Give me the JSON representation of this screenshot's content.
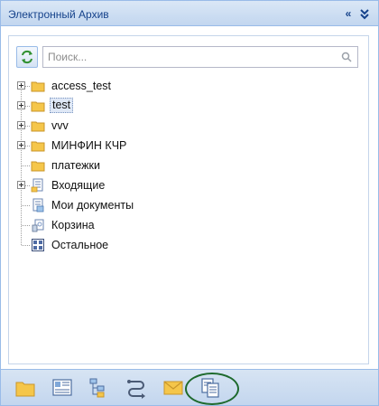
{
  "header": {
    "title": "Электронный Архив",
    "collapse_icon": "double-chevron-left-icon",
    "expand_icon": "double-chevron-down-icon"
  },
  "search": {
    "placeholder": "Поиск...",
    "value": ""
  },
  "tree": {
    "items": [
      {
        "label": "access_test",
        "icon": "folder-icon",
        "expandable": true,
        "selected": false
      },
      {
        "label": "test",
        "icon": "folder-icon",
        "expandable": true,
        "selected": true
      },
      {
        "label": "vvv",
        "icon": "folder-icon",
        "expandable": true,
        "selected": false
      },
      {
        "label": "МИНФИН КЧР",
        "icon": "folder-icon",
        "expandable": true,
        "selected": false
      },
      {
        "label": "платежки",
        "icon": "folder-icon",
        "expandable": false,
        "selected": false
      },
      {
        "label": "Входящие",
        "icon": "incoming-documents-icon",
        "expandable": true,
        "selected": false
      },
      {
        "label": "Мои документы",
        "icon": "my-documents-icon",
        "expandable": false,
        "selected": false
      },
      {
        "label": "Корзина",
        "icon": "recycle-bin-icon",
        "expandable": false,
        "selected": false
      },
      {
        "label": "Остальное",
        "icon": "other-grid-icon",
        "expandable": false,
        "selected": false
      }
    ]
  },
  "footer": {
    "buttons": [
      "folder-icon",
      "card-list-icon",
      "tree-structure-icon",
      "workflow-icon",
      "mail-icon",
      "documents-copy-icon"
    ],
    "highlighted": "documents-copy-icon"
  },
  "colors": {
    "header_text": "#15428b",
    "border": "#99bbe8",
    "folder": "#f5c64a",
    "highlight_ring": "#1e6a2d"
  }
}
